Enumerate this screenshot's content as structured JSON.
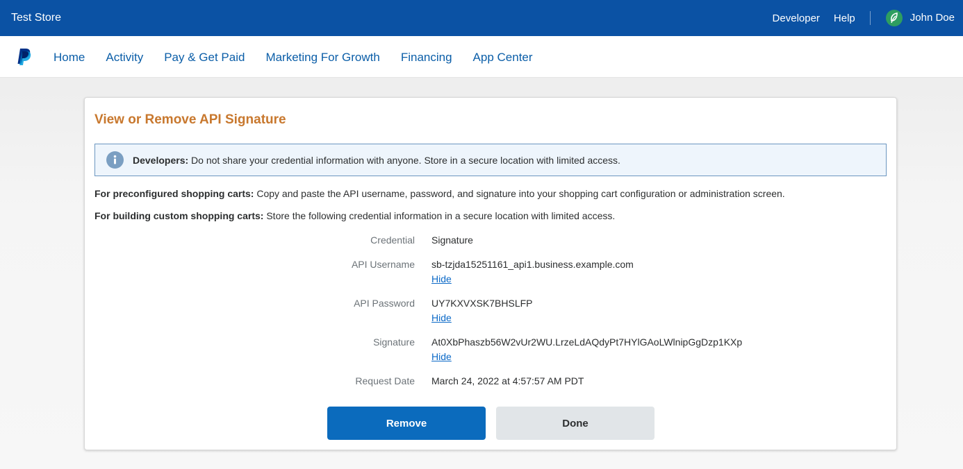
{
  "topbar": {
    "store_name": "Test Store",
    "links": [
      "Developer",
      "Help"
    ],
    "user_name": "John Doe",
    "avatar_icon": "leaf-icon",
    "brand_color": "#0b52a4"
  },
  "nav": {
    "logo_icon": "paypal-logo-icon",
    "items": [
      "Home",
      "Activity",
      "Pay & Get Paid",
      "Marketing For Growth",
      "Financing",
      "App Center"
    ]
  },
  "page": {
    "title": "View or Remove API Signature",
    "notice": {
      "icon": "info-icon",
      "bold": "Developers:",
      "text": " Do not share your credential information with anyone. Store in a secure location with limited access."
    },
    "para1": {
      "bold": "For preconfigured shopping carts:",
      "text": " Copy and paste the API username, password, and signature into your shopping cart configuration or administration screen."
    },
    "para2": {
      "bold": "For building custom shopping carts:",
      "text": " Store the following credential information in a secure location with limited access."
    },
    "credentials": {
      "credential": {
        "label": "Credential",
        "value": "Signature"
      },
      "username": {
        "label": "API Username",
        "value": "sb-tzjda15251161_api1.business.example.com",
        "hide": "Hide"
      },
      "password": {
        "label": "API Password",
        "value": "UY7KXVXSK7BHSLFP",
        "hide": "Hide"
      },
      "signature": {
        "label": "Signature",
        "value": "At0XbPhaszb56W2vUr2WU.LrzeLdAQdyPt7HYlGAoLWlnipGgDzp1KXp",
        "hide": "Hide"
      },
      "request_date": {
        "label": "Request Date",
        "value": "March 24, 2022 at 4:57:57 AM PDT"
      }
    },
    "buttons": {
      "remove": "Remove",
      "done": "Done"
    }
  }
}
